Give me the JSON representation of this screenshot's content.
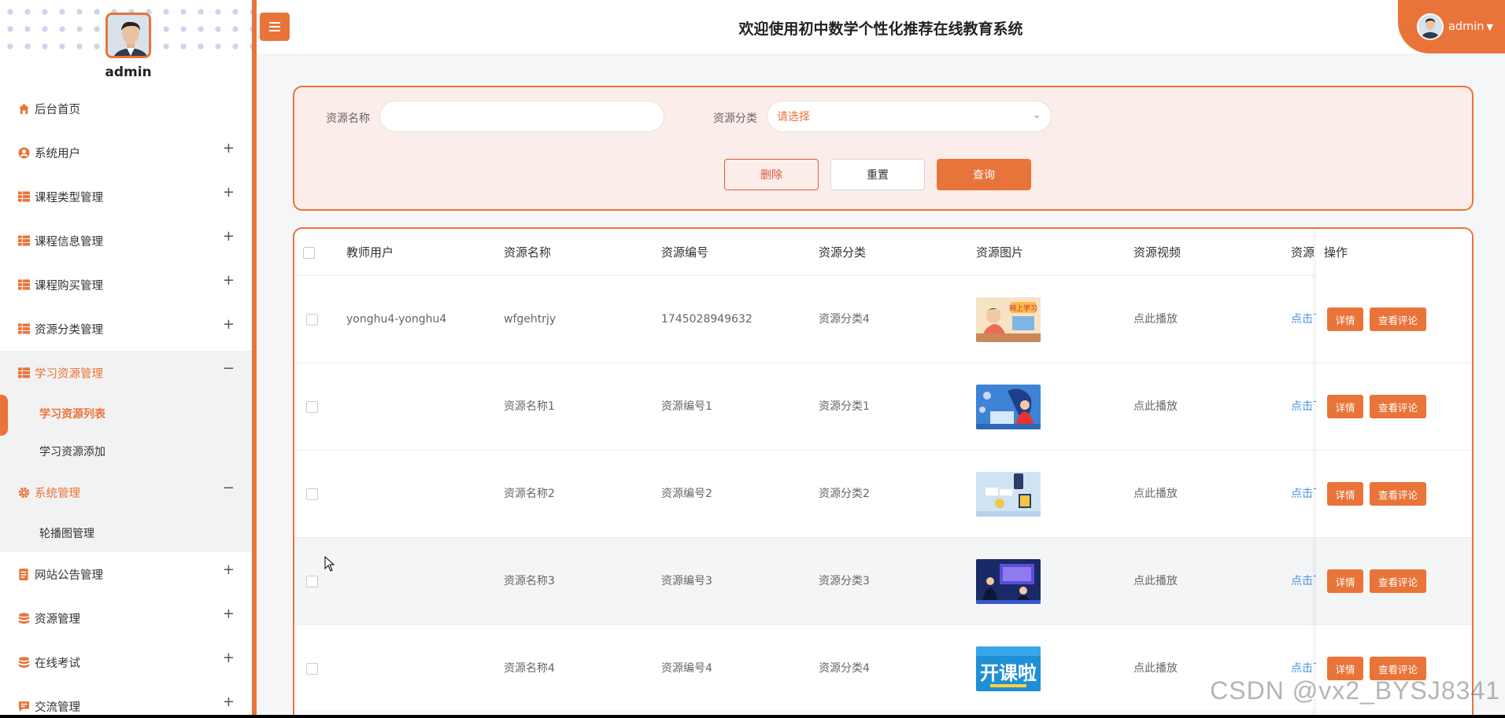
{
  "sidebar": {
    "username": "admin",
    "menu": [
      {
        "label": "后台首页",
        "icon": "home-icon",
        "toggle": ""
      },
      {
        "label": "系统用户",
        "icon": "user-circle-icon",
        "toggle": "+"
      },
      {
        "label": "课程类型管理",
        "icon": "grid-icon",
        "toggle": "+"
      },
      {
        "label": "课程信息管理",
        "icon": "grid-icon",
        "toggle": "+"
      },
      {
        "label": "课程购买管理",
        "icon": "grid-icon",
        "toggle": "+"
      },
      {
        "label": "资源分类管理",
        "icon": "grid-icon",
        "toggle": "+"
      },
      {
        "label": "学习资源管理",
        "icon": "grid-icon",
        "toggle": "−"
      },
      {
        "label": "系统管理",
        "icon": "gear-icon",
        "toggle": "−"
      },
      {
        "label": "网站公告管理",
        "icon": "notice-icon",
        "toggle": "+"
      },
      {
        "label": "资源管理",
        "icon": "database-icon",
        "toggle": "+"
      },
      {
        "label": "在线考试",
        "icon": "database-icon",
        "toggle": "+"
      },
      {
        "label": "交流管理",
        "icon": "chat-icon",
        "toggle": "+"
      }
    ],
    "sub_resources": [
      "学习资源列表",
      "学习资源添加"
    ],
    "sub_system": [
      "轮播图管理"
    ]
  },
  "topbar": {
    "title": "欢迎使用初中数学个性化推荐在线教育系统",
    "user": "admin"
  },
  "search": {
    "name_label": "资源名称",
    "name_value": "",
    "category_label": "资源分类",
    "category_placeholder": "请选择",
    "delete_label": "删除",
    "reset_label": "重置",
    "query_label": "查询"
  },
  "table": {
    "headers": [
      "教师用户",
      "资源名称",
      "资源编号",
      "资源分类",
      "资源图片",
      "资源视频",
      "资源"
    ],
    "op_header": "操作",
    "rows": [
      {
        "teacher": "yonghu4-yonghu4",
        "name": "wfgehtrjy",
        "code": "1745028949632",
        "category": "资源分类4",
        "video": "点此播放",
        "file": "点击下载"
      },
      {
        "teacher": "",
        "name": "资源名称1",
        "code": "资源编号1",
        "category": "资源分类1",
        "video": "点此播放",
        "file": "点击下载"
      },
      {
        "teacher": "",
        "name": "资源名称2",
        "code": "资源编号2",
        "category": "资源分类2",
        "video": "点此播放",
        "file": "点击下载"
      },
      {
        "teacher": "",
        "name": "资源名称3",
        "code": "资源编号3",
        "category": "资源分类3",
        "video": "点此播放",
        "file": "点击下载"
      },
      {
        "teacher": "",
        "name": "资源名称4",
        "code": "资源编号4",
        "category": "资源分类4",
        "video": "点此播放",
        "file": "点击下载"
      }
    ],
    "detail_label": "详情",
    "comment_label": "查看评论",
    "thumb_texts": [
      "网上学习",
      "",
      "",
      "",
      "开课啦"
    ]
  },
  "watermark": "CSDN @vx2_BYSJ8341",
  "colors": {
    "accent": "#e9743a",
    "link": "#4a90e2"
  }
}
